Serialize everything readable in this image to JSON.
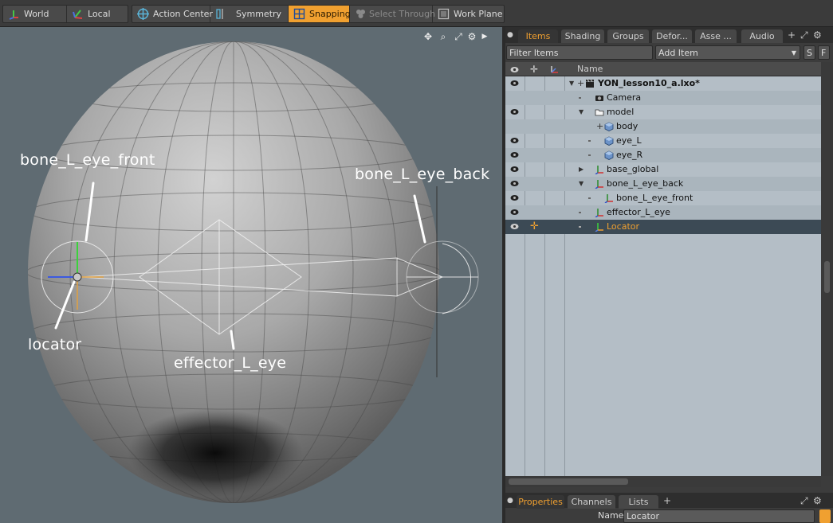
{
  "toolbar": {
    "world": "World",
    "local": "Local",
    "action_center": "Action Center",
    "symmetry": "Symmetry",
    "snapping": "Snapping",
    "select_through": "Select Through",
    "work_plane": "Work Plane"
  },
  "viewport": {
    "labels": {
      "bone_front": "bone_L_eye_front",
      "bone_back": "bone_L_eye_back",
      "locator": "locator",
      "effector": "effector_L_eye"
    }
  },
  "panel": {
    "tabs": [
      "Items",
      "Shading",
      "Groups",
      "Defor...",
      "Asse ...",
      "Audio"
    ],
    "filter_placeholder": "Filter Items",
    "add_item": "Add Item",
    "s_button": "S",
    "f_button": "F",
    "header_name": "Name",
    "rows": [
      {
        "label": "YON_lesson10_a.lxo*"
      },
      {
        "label": "Camera"
      },
      {
        "label": "model"
      },
      {
        "label": "body"
      },
      {
        "label": "eye_L"
      },
      {
        "label": "eye_R"
      },
      {
        "label": "base_global"
      },
      {
        "label": "bone_L_eye_back"
      },
      {
        "label": "bone_L_eye_front"
      },
      {
        "label": "effector_L_eye"
      },
      {
        "label": "Locator"
      }
    ],
    "bottom_tabs": [
      "Properties",
      "Channels",
      "Lists"
    ],
    "prop_name_label": "Name",
    "prop_name_value": "Locator"
  },
  "colors": {
    "accent": "#f0a030",
    "viewport_bg": "#5f6b72",
    "list_bg": "#b4bec6",
    "selected_row": "#3c4a55"
  }
}
